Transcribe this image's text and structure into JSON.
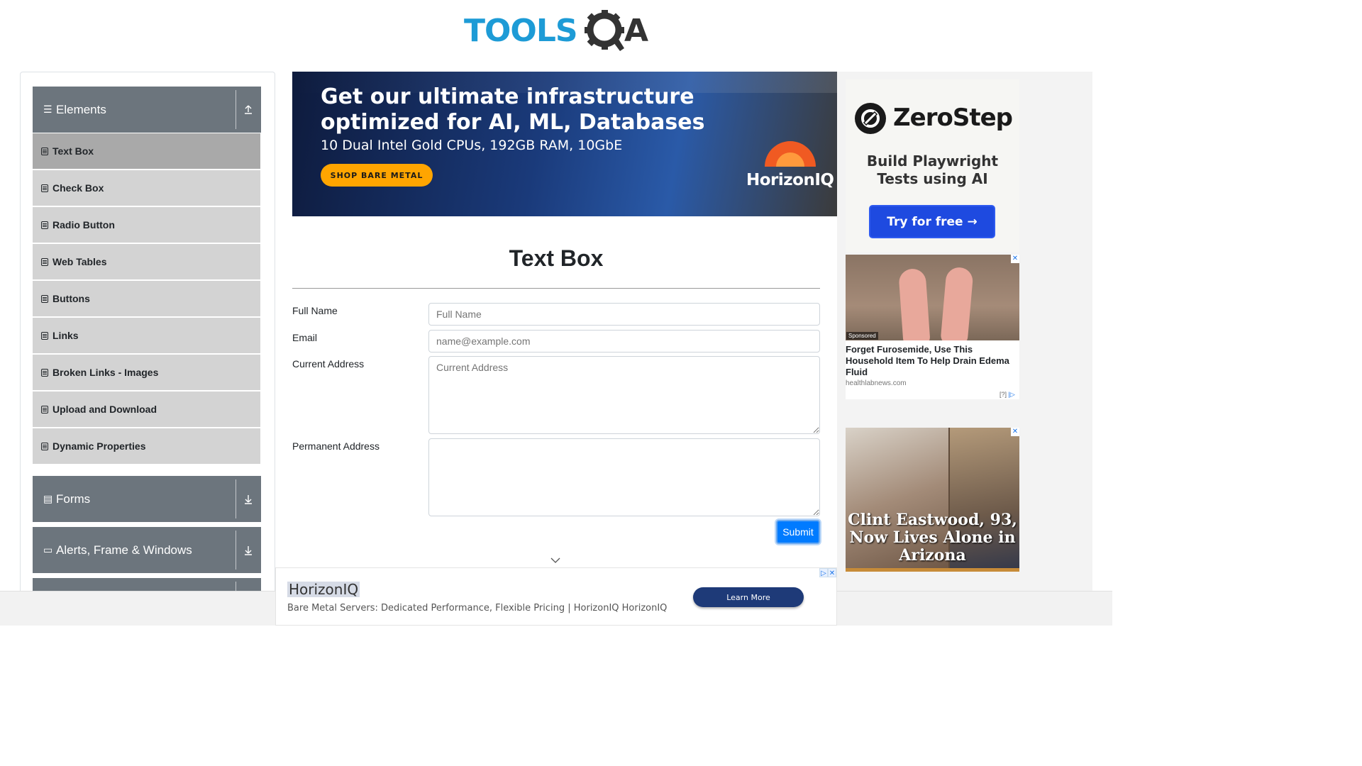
{
  "header": {
    "logo_left": "TOOLS",
    "logo_right": "A",
    "logo_alt": "ToolsQA"
  },
  "sidebar": {
    "groups": [
      {
        "label": "Elements"
      },
      {
        "label": "Forms"
      },
      {
        "label": "Alerts, Frame & Windows"
      }
    ],
    "items": [
      {
        "label": "Text Box"
      },
      {
        "label": "Check Box"
      },
      {
        "label": "Radio Button"
      },
      {
        "label": "Web Tables"
      },
      {
        "label": "Buttons"
      },
      {
        "label": "Links"
      },
      {
        "label": "Broken Links - Images"
      },
      {
        "label": "Upload and Download"
      },
      {
        "label": "Dynamic Properties"
      }
    ]
  },
  "banner": {
    "headline": "Get our ultimate infrastructure optimized for AI, ML, Databases",
    "sub": "10 Dual Intel Gold CPUs, 192GB RAM, 10GbE",
    "cta": "SHOP BARE METAL",
    "brand": "HorizonIQ"
  },
  "main": {
    "title": "Text Box",
    "form": {
      "full_name_label": "Full Name",
      "full_name_placeholder": "Full Name",
      "email_label": "Email",
      "email_placeholder": "name@example.com",
      "current_address_label": "Current Address",
      "current_address_placeholder": "Current Address",
      "permanent_address_label": "Permanent Address",
      "submit": "Submit"
    }
  },
  "ads": {
    "zerostep": {
      "brand": "ZeroStep",
      "tagline": "Build Playwright Tests using AI",
      "cta": "Try for free →"
    },
    "edema": {
      "sponsored": "Sponsored",
      "title": "Forget Furosemide, Use This Household Item To Help Drain Edema Fluid",
      "source": "healthlabnews.com",
      "info": "[?]"
    },
    "eastwood": {
      "headline": "Clint Eastwood, 93, Now Lives Alone in Arizona"
    },
    "bottom": {
      "brand": "HorizonIQ",
      "desc": "Bare Metal Servers: Dedicated Performance, Flexible Pricing | HorizonIQ HorizonIQ",
      "cta": "Learn More"
    }
  },
  "colors": {
    "sidebar_header": "#6c757d",
    "menu_item": "#d3d3d3",
    "menu_active": "#a9a9a9",
    "submit": "#007bff",
    "logo_blue": "#1d9bd6"
  }
}
